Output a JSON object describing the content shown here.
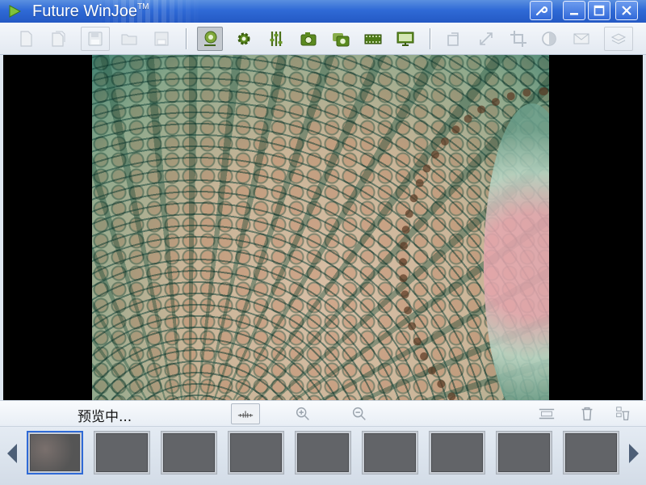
{
  "window": {
    "title": "Future WinJoe",
    "title_mark": "TM",
    "buttons": [
      "settings-wrench",
      "minimize",
      "maximize",
      "close"
    ]
  },
  "toolbar": {
    "icons": [
      "new-file",
      "open-file",
      "save-disk",
      "open-folder",
      "save",
      "camera-capture",
      "settings-gear",
      "adjust-sliders",
      "camera",
      "multi-camera",
      "film-strip",
      "display-screen",
      "rotate",
      "resize-arrows",
      "crop",
      "contrast",
      "envelope",
      "stack"
    ],
    "active": "camera-capture"
  },
  "preview": {
    "status_text": "预览中..."
  },
  "controls": {
    "icons": [
      "scale-ruler",
      "zoom-in",
      "zoom-out",
      "fit-screen",
      "trash",
      "delete-all"
    ]
  },
  "thumbnails": {
    "count": 9,
    "selected_index": 0
  },
  "colors": {
    "titlebar": "#2f6ad6",
    "icon_green": "#5b8a1f",
    "disabled_icon": "#b9c2cc"
  }
}
